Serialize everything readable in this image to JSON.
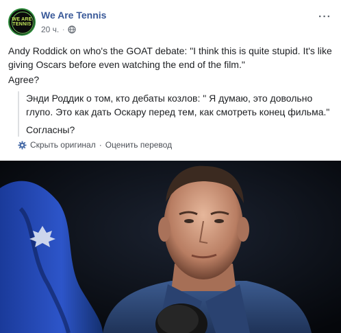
{
  "page": {
    "name": "We Are Tennis",
    "avatar_text_line1": "WE ARE",
    "avatar_text_line2": "TENNIS",
    "time": "20 ч.",
    "separator": "·",
    "privacy_icon": "globe-icon",
    "more_icon": "more-options-icon",
    "more_label": "···"
  },
  "post": {
    "text": "Andy Roddick on who's the GOAT debate: \"I think this is quite stupid. It's like giving Oscars before even watching the end of the film.\"",
    "question": "Agree?"
  },
  "translation": {
    "text": "Энди Роддик о том, кто дебаты козлов: \" Я думаю, это довольно глупо. Это как дать Оскару перед тем, как смотреть конец фильма.\"",
    "question": "Согласны?",
    "settings_icon": "gear-icon",
    "hide_original": "Скрыть оригинал",
    "separator": "·",
    "rate_translation": "Оценить перевод"
  },
  "colors": {
    "link": "#385898",
    "text": "#1c1e21",
    "meta": "#616770",
    "photo_bg": "#0a0d12",
    "flag": "#2d55c9",
    "shirt": "#2e4a78"
  }
}
